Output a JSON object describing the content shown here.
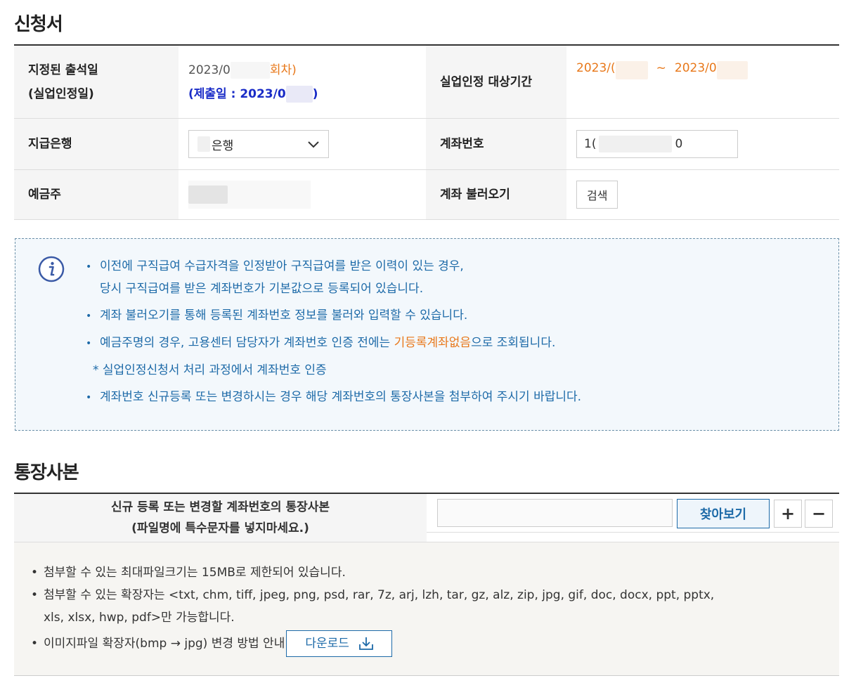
{
  "section1": {
    "title": "신청서"
  },
  "app": {
    "attend_label_1": "지정된 출석일",
    "attend_label_2": "(실업인정일)",
    "attend_value_prefix": "2023/0",
    "attend_value_suffix": "회차)",
    "submit_prefix": "(제출일 : 2023/0",
    "submit_suffix": ")",
    "period_label": "실업인정 대상기간",
    "period_start": "2023/(",
    "period_tilde": "~",
    "period_end": "2023/0",
    "bank_label": "지급은행",
    "bank_value": "은행",
    "account_label": "계좌번호",
    "account_prefix": "1(",
    "account_suffix": "0",
    "holder_label": "예금주",
    "load_label": "계좌 불러오기",
    "search_button": "검색"
  },
  "info": {
    "icon": "info-circle-icon",
    "line1": "이전에 구직급여 수급자격을 인정받아 구직급여를 받은 이력이 있는 경우,",
    "line1b": "당시 구직급여를 받은 계좌번호가 기본값으로 등록되어 있습니다.",
    "line2": "계좌 불러오기를 통해 등록된 계좌번호 정보를 불러와 입력할 수 있습니다.",
    "line3_prefix": "예금주명의 경우, 고용센터 담당자가 계좌번호 인증 전에는 ",
    "line3_highlight": "기등록계좌없음",
    "line3_suffix": "으로 조회됩니다.",
    "line4": "* 실업인정신청서 처리 과정에서 계좌번호 인증",
    "line5": "계좌번호 신규등록 또는 변경하시는 경우 해당 계좌번호의 통장사본을 첨부하여 주시기 바랍니다."
  },
  "section2": {
    "title": "통장사본"
  },
  "bankbook": {
    "label_1": "신규 등록 또는 변경할 계좌번호의 통장사본",
    "label_2": "(파일명에 특수문자를 넣지마세요.)",
    "find_button": "찾아보기",
    "plus": "+",
    "minus": "−"
  },
  "notes": {
    "line1": "첨부할 수 있는 최대파일크기는 15MB로 제한되어 있습니다.",
    "line2": "첨부할 수 있는 확장자는 <txt, chm, tiff, jpeg, png, psd, rar, 7z, arj, lzh, tar, gz, alz, zip, jpg, gif, doc, docx, ppt, pptx,",
    "line2b": "xls, xlsx, hwp, pdf>만 가능합니다.",
    "line3": "이미지파일 확장자(bmp → jpg) 변경 방법 안내",
    "download_button": "다운로드"
  },
  "colors": {
    "accent_blue": "#1d6aa8",
    "orange": "#e8781a",
    "submit_blue": "#1a2cc7"
  }
}
